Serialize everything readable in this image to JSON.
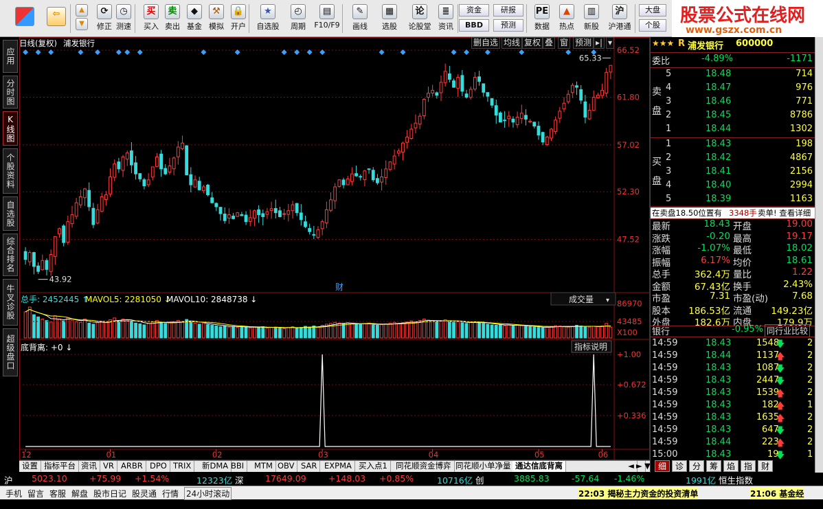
{
  "toolbar": {
    "buttons": [
      {
        "label": "修正",
        "icon": "refresh-icon"
      },
      {
        "label": "测速",
        "icon": "clock-icon"
      },
      {
        "label": "买入",
        "icon": "buy-icon"
      },
      {
        "label": "卖出",
        "icon": "sell-icon"
      },
      {
        "label": "基金",
        "icon": "fund-icon"
      },
      {
        "label": "模拟",
        "icon": "hammer-icon"
      },
      {
        "label": "开户",
        "icon": "lock-icon"
      },
      {
        "label": "自选股",
        "icon": "star-icon"
      },
      {
        "label": "周期",
        "icon": "period-icon"
      },
      {
        "label": "F10/F9",
        "icon": "f10-icon"
      },
      {
        "label": "画线",
        "icon": "pen-icon"
      },
      {
        "label": "选股",
        "icon": "select-icon"
      },
      {
        "label": "论股堂",
        "icon": "talk-icon"
      },
      {
        "label": "资讯",
        "icon": "news-icon"
      },
      {
        "label": "数据",
        "icon": "pe-icon"
      },
      {
        "label": "热点",
        "icon": "hot-icon"
      },
      {
        "label": "新股",
        "icon": "newstock-icon"
      },
      {
        "label": "沪港通",
        "icon": "hk-icon"
      }
    ],
    "mini": {
      "zijin": "资金",
      "bbd": "BBD",
      "yanbao": "研报",
      "yuce": "预测",
      "dapan": "大盘",
      "gegu": "个股"
    }
  },
  "brand": {
    "title": "股票公式在线网",
    "url": "www.gszx.com.cn"
  },
  "vtabs": [
    "应用",
    "分时图",
    "K线图",
    "个股资料",
    "自选股",
    "综合排名",
    "牛叉诊股",
    "超级盘口"
  ],
  "chart": {
    "period": "日线(复权)",
    "stock": "浦发银行",
    "tools": [
      "删自选",
      "均线",
      "复权",
      "叠",
      "窗",
      "预测"
    ],
    "y_labels": [
      "66.52",
      "61.80",
      "57.02",
      "52.30",
      "47.52"
    ],
    "hi_label": "65.33",
    "lo_label": "43.92",
    "cai": "财",
    "vol_title": "总手: 2452445",
    "vol_ma5": "MAVOL5: 2281050",
    "vol_ma10": "MAVOL10: 2848738",
    "vol_select": "成交量",
    "vol_y": [
      "86970",
      "43485",
      "X100"
    ],
    "ind_title": "底背离: +0",
    "ind_help": "指标说明",
    "ind_y": [
      "+1.00",
      "+0.672",
      "+0.336"
    ],
    "x_labels": [
      "12",
      "01",
      "02",
      "03",
      "04",
      "05",
      "06"
    ]
  },
  "chart_data": [
    {
      "type": "candlestick",
      "title": "日线(复权) 浦发银行",
      "ylim": [
        43.0,
        66.6
      ],
      "annotations": {
        "high": 65.33,
        "low": 43.92
      },
      "note": "approx. close path per trading day",
      "closes": [
        45.5,
        46.2,
        44.8,
        44.3,
        45.4,
        44.5,
        46.0,
        47.8,
        48.6,
        47.2,
        49.3,
        50.0,
        51.2,
        51.8,
        52.6,
        50.8,
        49.0,
        50.5,
        51.8,
        52.0,
        53.8,
        55.1,
        54.6,
        55.8,
        56.2,
        55.0,
        54.1,
        53.6,
        52.9,
        53.5,
        54.8,
        55.8,
        54.6,
        54.1,
        54.9,
        55.7,
        56.8,
        57.2,
        54.0,
        53.0,
        53.5,
        52.5,
        52.8,
        52.0,
        51.2,
        50.8,
        50.1,
        49.4,
        50.0,
        49.6,
        50.2,
        49.9,
        49.3,
        49.7,
        50.4,
        50.0,
        49.8,
        50.3,
        50.6,
        50.2,
        49.8,
        50.1,
        50.4,
        51.0,
        50.2,
        49.5,
        48.8,
        48.3,
        48.0,
        48.5,
        49.3,
        50.5,
        51.5,
        52.8,
        53.5,
        53.0,
        53.6,
        54.1,
        53.9,
        53.8,
        54.4,
        54.6,
        53.5,
        53.2,
        53.8,
        54.6,
        55.3,
        55.9,
        56.4,
        57.2,
        57.8,
        58.6,
        59.2,
        59.9,
        61.6,
        62.2,
        62.5,
        62.0,
        63.3,
        64.4,
        63.6,
        62.8,
        63.8,
        62.4,
        61.8,
        62.6,
        63.8,
        63.4,
        62.3,
        61.9,
        61.0,
        60.0,
        59.3,
        59.5,
        59.9,
        59.3,
        59.8,
        60.2,
        59.6,
        59.4,
        58.9,
        58.0,
        57.3,
        57.8,
        58.6,
        59.5,
        60.4,
        61.2,
        62.1,
        63.0,
        62.8,
        61.5,
        59.8,
        60.5,
        61.8,
        62.0,
        62.5,
        64.3,
        65.0
      ],
      "dates_axis": [
        "12",
        "01",
        "02",
        "03",
        "04",
        "05",
        "06"
      ]
    },
    {
      "type": "bar",
      "title": "成交量",
      "values_note": "×100 lots",
      "series": [
        {
          "name": "MAVOL5",
          "last": 2281050
        },
        {
          "name": "MAVOL10",
          "last": 2848738
        }
      ],
      "ylim": [
        0,
        86970
      ],
      "volumes": [
        72000,
        85000,
        64000,
        58000,
        52000,
        48000,
        44000,
        61000,
        52000,
        47000,
        55000,
        49000,
        45000,
        43000,
        52000,
        41000,
        38000,
        42000,
        46000,
        43000,
        50000,
        55000,
        47000,
        52000,
        49000,
        45000,
        41000,
        39000,
        36000,
        40000,
        44000,
        48000,
        43000,
        40000,
        42000,
        45000,
        48000,
        46000,
        51000,
        44000,
        41000,
        38000,
        40000,
        37000,
        35000,
        33000,
        31000,
        34000,
        30000,
        32000,
        29000,
        31000,
        30000,
        28000,
        30000,
        29000,
        31000,
        27000,
        29000,
        30000,
        28000,
        26000,
        29000,
        31000,
        27000,
        29000,
        32000,
        30000,
        33000,
        30000,
        35000,
        38000,
        40000,
        43000,
        41000,
        39000,
        42000,
        40000,
        38000,
        37000,
        39000,
        41000,
        36000,
        35000,
        37000,
        39000,
        41000,
        43000,
        40000,
        42000,
        44000,
        47000,
        45000,
        48000,
        52000,
        49000,
        46000,
        44000,
        47000,
        50000,
        46000,
        43000,
        45000,
        42000,
        40000,
        43000,
        45000,
        42000,
        40000,
        38000,
        36000,
        35000,
        37000,
        34000,
        36000,
        33000,
        35000,
        34000,
        32000,
        31000,
        30000,
        29000,
        28000,
        30000,
        32000,
        34000,
        33000,
        31000,
        30000,
        32000,
        35000,
        33000,
        31000,
        30000,
        32000,
        31000,
        33000,
        40000,
        30000
      ]
    },
    {
      "type": "line",
      "title": "底背离",
      "ylim": [
        0,
        1.1
      ],
      "spikes_at_index": [
        70,
        134
      ],
      "value": 0
    }
  ],
  "quote": {
    "stars": "★★★",
    "code_prefix": "R",
    "name": "浦发银行",
    "code": "600000",
    "weibi_label": "委比",
    "weibi_pct": "-4.89%",
    "weibi_val": "-1171",
    "sell_label": "卖盘",
    "buy_label": "买盘",
    "sell": [
      {
        "lv": "5",
        "price": "18.48",
        "vol": "714"
      },
      {
        "lv": "4",
        "price": "18.47",
        "vol": "976"
      },
      {
        "lv": "3",
        "price": "18.46",
        "vol": "771"
      },
      {
        "lv": "2",
        "price": "18.45",
        "vol": "8786"
      },
      {
        "lv": "1",
        "price": "18.44",
        "vol": "1302"
      }
    ],
    "buy": [
      {
        "lv": "1",
        "price": "18.43",
        "vol": "198"
      },
      {
        "lv": "2",
        "price": "18.42",
        "vol": "4867"
      },
      {
        "lv": "3",
        "price": "18.41",
        "vol": "2156"
      },
      {
        "lv": "4",
        "price": "18.40",
        "vol": "2994"
      },
      {
        "lv": "5",
        "price": "18.39",
        "vol": "1163"
      }
    ],
    "notice": "在卖盘18.50位置有",
    "notice_vol": "3348手",
    "notice_action": "卖单! 查看详细",
    "stats": [
      [
        "最新",
        "18.43",
        "开盘",
        "19.00"
      ],
      [
        "涨跌",
        "-0.20",
        "最高",
        "19.17"
      ],
      [
        "涨幅",
        "-1.07%",
        "最低",
        "18.02"
      ],
      [
        "振幅",
        "6.17%",
        "均价",
        "18.61"
      ],
      [
        "总手",
        "362.4万",
        "量比",
        "1.22"
      ],
      [
        "金额",
        "67.43亿",
        "换手",
        "2.43%"
      ],
      [
        "市盈",
        "7.31",
        "市盈(动)",
        "7.68"
      ],
      [
        "股本",
        "186.53亿",
        "流通",
        "149.23亿"
      ],
      [
        "外盘",
        "182.6万",
        "内盘",
        "179.9万"
      ]
    ],
    "industry": "银行",
    "industry_pct": "-0.95%",
    "industry_btn": "同行业比较",
    "ticks": [
      {
        "t": "14:59",
        "p": "18.43",
        "v": "1548",
        "d": "dn",
        "n": "2"
      },
      {
        "t": "14:59",
        "p": "18.44",
        "v": "1137",
        "d": "up",
        "n": "2"
      },
      {
        "t": "14:59",
        "p": "18.43",
        "v": "1087",
        "d": "dn",
        "n": "2"
      },
      {
        "t": "14:59",
        "p": "18.43",
        "v": "2447",
        "d": "dn",
        "n": "2"
      },
      {
        "t": "14:59",
        "p": "18.43",
        "v": "1539",
        "d": "up",
        "n": "2"
      },
      {
        "t": "14:59",
        "p": "18.43",
        "v": "182",
        "d": "up",
        "n": "1"
      },
      {
        "t": "14:59",
        "p": "18.43",
        "v": "1635",
        "d": "up",
        "n": "2"
      },
      {
        "t": "14:59",
        "p": "18.43",
        "v": "647",
        "d": "dn",
        "n": "2"
      },
      {
        "t": "14:59",
        "p": "18.44",
        "v": "223",
        "d": "up",
        "n": "2"
      },
      {
        "t": "15:00",
        "p": "18.43",
        "v": "19",
        "d": "dn",
        "n": "1"
      }
    ],
    "bottom_tabs": [
      "细",
      "诊",
      "分",
      "筹",
      "焰",
      "指",
      "财"
    ]
  },
  "itabs": [
    "设置",
    "指标平台",
    "资讯",
    "VR",
    "ARBR",
    "DPO",
    "TRIX",
    "新DMA",
    "BBI",
    "MTM",
    "OBV",
    "SAR",
    "EXPMA",
    "买入点1",
    "同花顺资金博弈",
    "同花顺小单净量",
    "通达信底背离"
  ],
  "status1": {
    "sh_label": "沪",
    "sh_val": "5023.10",
    "sh_chg": "+75.99",
    "sh_pct": "+1.54%",
    "sh_amt": "12323亿",
    "sz_label": "深",
    "sz_val": "17649.09",
    "sz_chg": "+148.03",
    "sz_pct": "+0.85%",
    "sz_amt": "10716亿",
    "cy_label": "创",
    "cy_val": "3885.83",
    "cy_chg": "-57.64",
    "cy_pct": "-1.46%",
    "cy_amt": "1991亿",
    "hs_label": "恒生指数"
  },
  "status2": {
    "items": [
      "手机",
      "留言",
      "客服",
      "解盘",
      "股市日记",
      "股灵通",
      "行情",
      "24小时滚动"
    ],
    "news1": "22:03 揭秘主力资金的投资清单",
    "news2": "21:06 基金经"
  },
  "colors": {
    "up": "#ff3c3c",
    "down": "#36dcdc",
    "grid": "#7a0c0c",
    "ma": "#ffffff"
  }
}
